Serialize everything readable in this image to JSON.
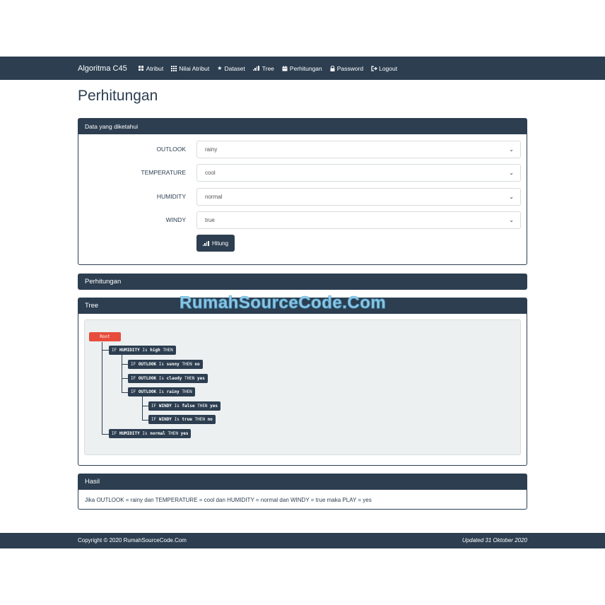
{
  "navbar": {
    "brand": "Algoritma C45",
    "items": [
      {
        "label": "Atribut",
        "icon": "grid-four-icon"
      },
      {
        "label": "Nilai Atribut",
        "icon": "grid-nine-icon"
      },
      {
        "label": "Dataset",
        "icon": "star-icon"
      },
      {
        "label": "Tree",
        "icon": "signal-bars-icon"
      },
      {
        "label": "Perhitungan",
        "icon": "calendar-icon"
      },
      {
        "label": "Password",
        "icon": "lock-icon"
      },
      {
        "label": "Logout",
        "icon": "logout-icon"
      }
    ]
  },
  "page": {
    "title": "Perhitungan"
  },
  "form_card": {
    "title": "Data yang diketahui",
    "fields": [
      {
        "label": "OUTLOOK",
        "value": "rainy"
      },
      {
        "label": "TEMPERATURE",
        "value": "cool"
      },
      {
        "label": "HUMIDITY",
        "value": "normal"
      },
      {
        "label": "WINDY",
        "value": "true"
      }
    ],
    "submit_label": "Hitung"
  },
  "perhitungan_card": {
    "title": "Perhitungan"
  },
  "tree_card": {
    "title": "Tree",
    "root_label": "Root",
    "nodes": [
      {
        "pre": "IF",
        "attr": "HUMIDITY",
        "is": "Is",
        "val": "high",
        "then": "THEN",
        "res": ""
      },
      {
        "pre": "IF",
        "attr": "OUTLOOK",
        "is": "Is",
        "val": "sunny",
        "then": "THEN",
        "res": "no"
      },
      {
        "pre": "IF",
        "attr": "OUTLOOK",
        "is": "Is",
        "val": "claudy",
        "then": "THEN",
        "res": "yes"
      },
      {
        "pre": "IF",
        "attr": "OUTLOOK",
        "is": "Is",
        "val": "rainy",
        "then": "THEN",
        "res": ""
      },
      {
        "pre": "IF",
        "attr": "WINDY",
        "is": "Is",
        "val": "false",
        "then": "THEN",
        "res": "yes"
      },
      {
        "pre": "IF",
        "attr": "WINDY",
        "is": "Is",
        "val": "true",
        "then": "THEN",
        "res": "no"
      },
      {
        "pre": "IF",
        "attr": "HUMIDITY",
        "is": "Is",
        "val": "normal",
        "then": "THEN",
        "res": "yes"
      }
    ]
  },
  "hasil_card": {
    "title": "Hasil",
    "text": "Jika OUTLOOK = rainy dan TEMPERATURE = cool dan HUMIDITY = normal dan WINDY = true maka PLAY = yes"
  },
  "watermark": "RumahSourceCode.Com",
  "footer": {
    "copyright": "Copyright © 2020 RumahSourceCode.Com",
    "updated": "Updated 31 Oktober 2020"
  },
  "colors": {
    "primary": "#2c3e50",
    "root": "#e74c3c",
    "tree_bg": "#ecf0f1"
  }
}
